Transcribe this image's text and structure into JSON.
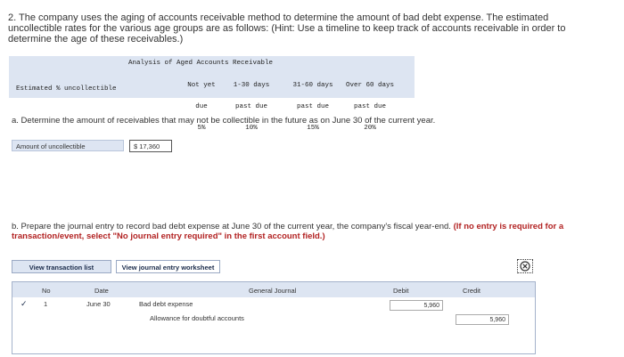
{
  "question": {
    "text": "2. The company uses the aging of accounts receivable method to determine the amount of bad debt expense. The estimated uncollectible rates for the various age groups are as follows: (Hint: Use a timeline to keep track of accounts receivable in order to determine the age of these receivables.)"
  },
  "aging": {
    "title": "Analysis of Aged Accounts Receivable",
    "row_label": "Estimated % uncollectible",
    "columns": [
      {
        "header1": "Not yet",
        "header2": "due",
        "value": "5%"
      },
      {
        "header1": "1-30 days",
        "header2": "past due",
        "value": "10%"
      },
      {
        "header1": "31-60 days",
        "header2": "past due",
        "value": "15%"
      },
      {
        "header1": "Over 60 days",
        "header2": "past due",
        "value": "20%"
      }
    ]
  },
  "part_a": {
    "text": "a. Determine the amount of receivables that may not be collectible in the future as on June 30 of the current year.",
    "label": "Amount of uncollectible",
    "value": "$  17,360"
  },
  "part_b": {
    "text": "b. Prepare the journal entry to record bad debt expense at June 30 of the current year, the company's fiscal year-end.",
    "bold": "(If no entry is required for a transaction/event, select \"No journal entry required\" in the first account field.)"
  },
  "buttons": {
    "transaction_list": "View transaction list",
    "worksheet": "View journal entry worksheet"
  },
  "journal": {
    "headers": {
      "no": "No",
      "date": "Date",
      "general_journal": "General Journal",
      "debit": "Debit",
      "credit": "Credit"
    },
    "row": {
      "no": "1",
      "date": "June 30",
      "debit_account": "Bad debt expense",
      "credit_account": "Allowance for doubtful accounts",
      "debit": "5,960",
      "credit": "5,960"
    }
  }
}
